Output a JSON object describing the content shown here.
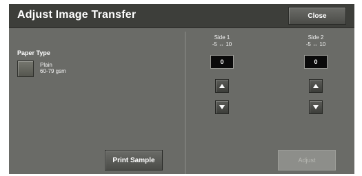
{
  "window": {
    "title": "Adjust Image Transfer",
    "close_label": "Close"
  },
  "paper_type": {
    "heading": "Paper Type",
    "name": "Plain",
    "weight": "60-79 gsm"
  },
  "sides": [
    {
      "label": "Side 1",
      "range": "-5 ↔ 10",
      "value": "0"
    },
    {
      "label": "Side 2",
      "range": "-5 ↔ 10",
      "value": "0"
    }
  ],
  "buttons": {
    "print_sample": "Print Sample",
    "adjust": "Adjust"
  },
  "icons": {
    "increase": "up-arrow-icon",
    "decrease": "down-arrow-icon"
  },
  "colors": {
    "panel": "#6a6b67",
    "titlebar": "#3d3e3a",
    "value_box": "#0a0a0a"
  }
}
